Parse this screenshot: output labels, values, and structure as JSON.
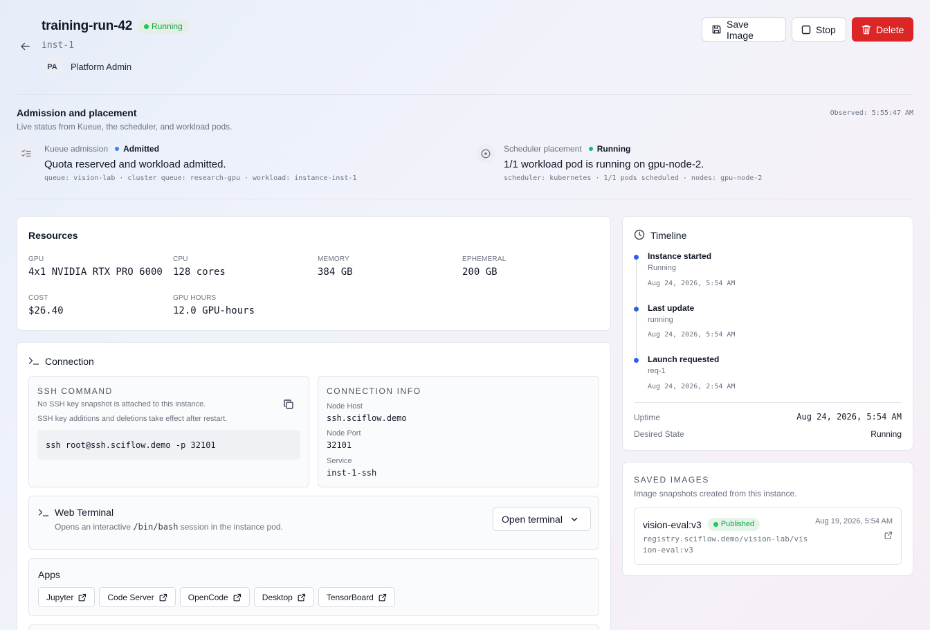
{
  "header": {
    "title": "training-run-42",
    "status": "Running",
    "instance_id": "inst-1",
    "owner_initials": "PA",
    "owner_name": "Platform Admin",
    "buttons": {
      "save_image": "Save Image",
      "stop": "Stop",
      "delete": "Delete"
    }
  },
  "admission": {
    "title": "Admission and placement",
    "subtitle": "Live status from Kueue, the scheduler, and workload pods.",
    "observed": "Observed: 5:55:47 AM",
    "kueue": {
      "label": "Kueue admission",
      "status": "Admitted",
      "message": "Quota reserved and workload admitted.",
      "meta": "queue: vision-lab · cluster queue: research-gpu · workload: instance-inst-1"
    },
    "scheduler": {
      "label": "Scheduler placement",
      "status": "Running",
      "message": "1/1 workload pod is running on gpu-node-2.",
      "meta": "scheduler: kubernetes · 1/1 pods scheduled · nodes: gpu-node-2"
    }
  },
  "resources": {
    "title": "Resources",
    "items": [
      {
        "label": "GPU",
        "value": "4x1 NVIDIA RTX PRO 6000"
      },
      {
        "label": "CPU",
        "value": "128 cores"
      },
      {
        "label": "MEMORY",
        "value": "384 GB"
      },
      {
        "label": "EPHEMERAL",
        "value": "200 GB"
      },
      {
        "label": "COST",
        "value": "$26.40"
      },
      {
        "label": "GPU HOURS",
        "value": "12.0 GPU-hours"
      }
    ]
  },
  "connection": {
    "title": "Connection",
    "ssh": {
      "heading": "SSH COMMAND",
      "note1": "No SSH key snapshot is attached to this instance.",
      "note2": "SSH key additions and deletions take effect after restart.",
      "command": "ssh root@ssh.sciflow.demo -p 32101"
    },
    "info": {
      "heading": "CONNECTION INFO",
      "fields": [
        {
          "label": "Node Host",
          "value": "ssh.sciflow.demo"
        },
        {
          "label": "Node Port",
          "value": "32101"
        },
        {
          "label": "Service",
          "value": "inst-1-ssh"
        }
      ]
    },
    "web_terminal": {
      "title": "Web Terminal",
      "desc_pre": "Opens an interactive",
      "desc_code": "/bin/bash",
      "desc_post": "session in the instance pod.",
      "button": "Open terminal"
    },
    "apps": {
      "title": "Apps",
      "items": [
        "Jupyter",
        "Code Server",
        "OpenCode",
        "Desktop",
        "TensorBoard"
      ]
    }
  },
  "timeline": {
    "title": "Timeline",
    "events": [
      {
        "title": "Instance started",
        "sub": "Running",
        "time": "Aug 24, 2026, 5:54 AM"
      },
      {
        "title": "Last update",
        "sub": "running",
        "time": "Aug 24, 2026, 5:54 AM"
      },
      {
        "title": "Launch requested",
        "sub": "req-1",
        "time": "Aug 24, 2026, 2:54 AM"
      }
    ],
    "uptime_label": "Uptime",
    "uptime_value": "Aug 24, 2026, 5:54 AM",
    "desired_label": "Desired State",
    "desired_value": "Running"
  },
  "saved_images": {
    "heading": "SAVED IMAGES",
    "subtitle": "Image snapshots created from this instance.",
    "items": [
      {
        "name": "vision-eval:v3",
        "status": "Published",
        "date": "Aug 19, 2026, 5:54 AM",
        "ref": "registry.sciflow.demo/vision-lab/vision-eval:v3"
      }
    ]
  },
  "colors": {
    "accent": "#2563eb",
    "danger": "#dc2626",
    "success": "#22c55e"
  }
}
